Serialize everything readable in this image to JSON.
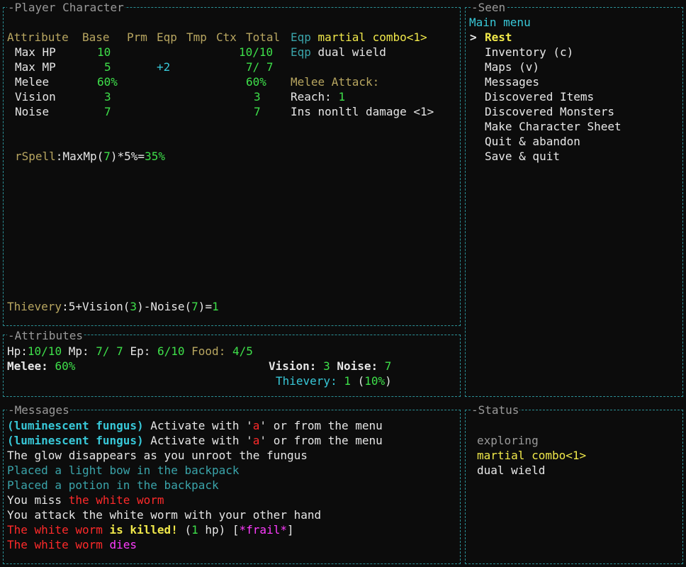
{
  "player_panel": {
    "title": "Player Character",
    "headers": {
      "attribute": "Attribute",
      "base": "Base",
      "prm": "Prm",
      "eqp": "Eqp",
      "tmp": "Tmp",
      "ctx": "Ctx",
      "total": "Total"
    },
    "rows": [
      {
        "name": "Max HP",
        "base": "10",
        "eqp": "",
        "total": "10/10"
      },
      {
        "name": "Max MP",
        "base": "5",
        "eqp": "+2",
        "total": "7/ 7"
      },
      {
        "name": "Melee",
        "base": "60%",
        "eqp": "",
        "total": "60%"
      },
      {
        "name": "Vision",
        "base": "3",
        "eqp": "",
        "total": "3"
      },
      {
        "name": "Noise",
        "base": "7",
        "eqp": "",
        "total": "7"
      }
    ],
    "equip": [
      {
        "tag": "Eqp",
        "name": "martial combo<1>"
      },
      {
        "tag": "Eqp",
        "name": "dual wield"
      }
    ],
    "melee_attack": {
      "label": "Melee Attack:",
      "reach_label": "Reach:",
      "reach_value": "1",
      "damage": "Ins nonltl damage <1>"
    },
    "rspell": {
      "label": "rSpell",
      "sep": ":",
      "term": "MaxMp",
      "open": "(",
      "val": "7",
      "close": ")",
      "mult": "*5%=",
      "result": "35%"
    },
    "thievery": {
      "label": "Thievery",
      "sep": ":",
      "base": "5",
      "plus": "+",
      "vision_label": "Vision",
      "vision_val": "3",
      "minus": "-",
      "noise_label": "Noise",
      "noise_val": "7",
      "eq": "=",
      "result": "1"
    }
  },
  "attributes_panel": {
    "title": "Attributes",
    "hp_label": "Hp:",
    "hp": "10/10",
    "mp_label": "Mp:",
    "mp": "7/ 7",
    "ep_label": "Ep:",
    "ep": "6/10",
    "food_label": "Food:",
    "food": "4/5",
    "melee_label": "Melee:",
    "melee": "60%",
    "vision_label": "Vision:",
    "vision": "3",
    "noise_label": "Noise:",
    "noise": "7",
    "thievery_label": "Thievery:",
    "thievery": "1",
    "thievery_pct": "10%"
  },
  "seen_panel": {
    "title": "Seen",
    "menu_title": "Main menu",
    "cursor": ">",
    "items": [
      "Rest",
      "Inventory (c)",
      "Maps (v)",
      "Messages",
      "Discovered Items",
      "Discovered Monsters",
      "Make Character Sheet",
      "Quit & abandon",
      "Save & quit"
    ]
  },
  "messages_panel": {
    "title": "Messages",
    "lines": {
      "l1": {
        "a": "(luminescent fungus)",
        "b": " Activate with '",
        "c": "a",
        "d": "' or from the menu"
      },
      "l2": {
        "a": "(luminescent fungus)",
        "b": " Activate with '",
        "c": "a",
        "d": "' or from the menu"
      },
      "l3": "The glow disappears as you unroot the fungus",
      "l4": "Placed a light bow in the backpack",
      "l5": "Placed a potion in the backpack",
      "l6": {
        "a": "You miss ",
        "b": "the white worm"
      },
      "l7": "You attack the white worm with your other hand",
      "l8": {
        "a": "The white worm",
        "b": " is killed!",
        "c": " (",
        "d": "1",
        "e": " hp) [",
        "f": "*frail*",
        "g": "]"
      },
      "l9": {
        "a": "The white worm",
        "b": " dies"
      }
    }
  },
  "status_panel": {
    "title": "Status",
    "items": [
      "exploring",
      "martial combo<1>",
      "dual wield"
    ]
  }
}
